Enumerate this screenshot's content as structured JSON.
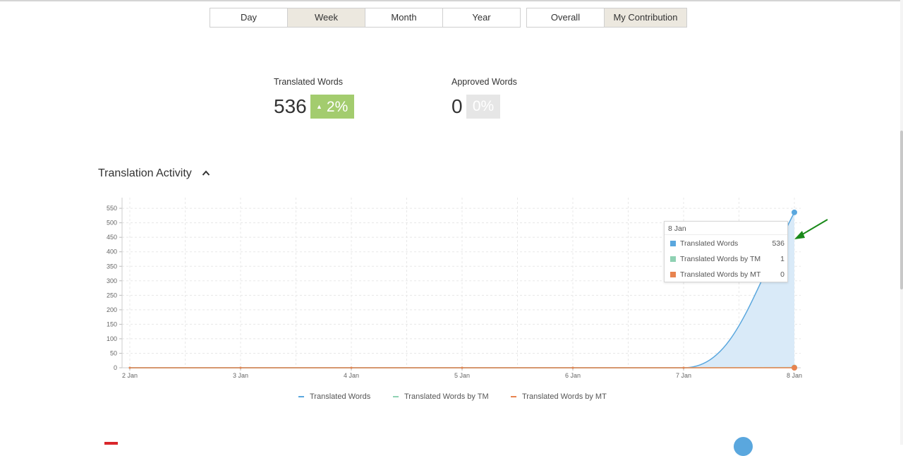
{
  "period_tabs": [
    {
      "label": "Day",
      "active": false
    },
    {
      "label": "Week",
      "active": true
    },
    {
      "label": "Month",
      "active": false
    },
    {
      "label": "Year",
      "active": false
    }
  ],
  "scope_tabs": [
    {
      "label": "Overall",
      "active": false
    },
    {
      "label": "My Contribution",
      "active": true
    }
  ],
  "stats": {
    "translated": {
      "label": "Translated Words",
      "value": "536",
      "change": "2%",
      "trend": "up",
      "badge_color": "#a3cc6e"
    },
    "approved": {
      "label": "Approved Words",
      "value": "0",
      "change": "0%",
      "badge_color": "#e6e6e6"
    }
  },
  "section": {
    "title": "Translation Activity",
    "icon": "chevron-up-icon",
    "expanded": true
  },
  "chart_data": {
    "type": "area",
    "x": [
      "2 Jan",
      "3 Jan",
      "4 Jan",
      "5 Jan",
      "6 Jan",
      "7 Jan",
      "8 Jan"
    ],
    "y_ticks": [
      "0",
      "50",
      "100",
      "150",
      "200",
      "250",
      "300",
      "350",
      "400",
      "450",
      "500",
      "550"
    ],
    "ylim": [
      0,
      560
    ],
    "grid": true,
    "legend_position": "bottom",
    "series": [
      {
        "name": "Translated Words",
        "values": [
          0,
          0,
          0,
          0,
          0,
          0,
          536
        ],
        "color": "#5aa7de",
        "fill": "#d9eaf8"
      },
      {
        "name": "Translated Words by TM",
        "values": [
          0,
          0,
          0,
          0,
          0,
          0,
          1
        ],
        "color": "#8fd1b3"
      },
      {
        "name": "Translated Words by MT",
        "values": [
          0,
          0,
          0,
          0,
          0,
          0,
          0
        ],
        "color": "#e8834f"
      }
    ]
  },
  "tooltip": {
    "date": "8 Jan",
    "rows": [
      {
        "name": "Translated Words",
        "value": "536",
        "color": "#5aa7de"
      },
      {
        "name": "Translated Words by TM",
        "value": "1",
        "color": "#8fd1b3"
      },
      {
        "name": "Translated Words by MT",
        "value": "0",
        "color": "#e8834f"
      }
    ]
  },
  "annotation_arrow_color": "#1a8a1a"
}
